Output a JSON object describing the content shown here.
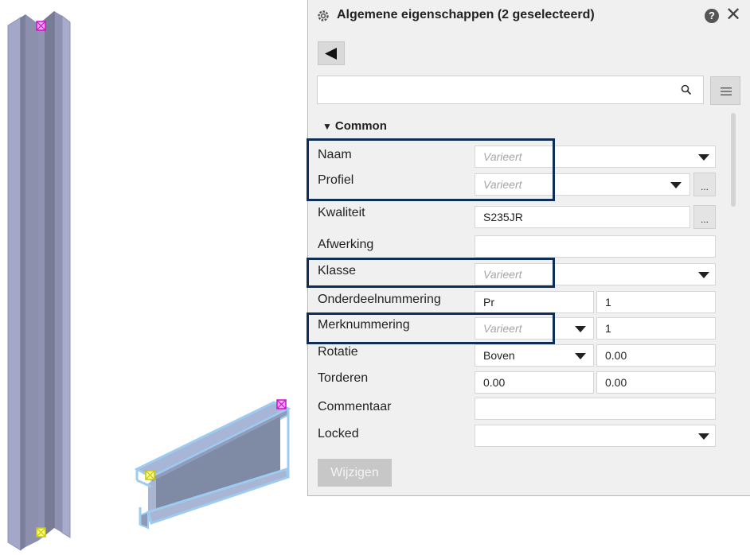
{
  "panel": {
    "title": "Algemene eigenschappen (2 geselecteerd)",
    "help_icon": "?",
    "close_icon": "✕",
    "search": {
      "value": "",
      "placeholder": ""
    },
    "section": "Common",
    "submit_label": "Wijzigen"
  },
  "properties": {
    "naam": {
      "label": "Naam",
      "value": "Varieert"
    },
    "profiel": {
      "label": "Profiel",
      "value": "Varieert",
      "extra": "..."
    },
    "kwaliteit": {
      "label": "Kwaliteit",
      "value": "S235JR",
      "extra": "..."
    },
    "afwerking": {
      "label": "Afwerking",
      "value": ""
    },
    "klasse": {
      "label": "Klasse",
      "value": "Varieert"
    },
    "onderdeelnummering": {
      "label": "Onderdeelnummering",
      "prefix": "Pr",
      "start": "1"
    },
    "merknummering": {
      "label": "Merknummering",
      "prefix": "Varieert",
      "start": "1"
    },
    "rotatie": {
      "label": "Rotatie",
      "value": "Boven",
      "offset": "0.00"
    },
    "tordeeren": {
      "label": "Torderen",
      "value1": "0.00",
      "value2": "0.00"
    },
    "commentaar": {
      "label": "Commentaar",
      "value": ""
    },
    "locked": {
      "label": "Locked",
      "value": ""
    }
  },
  "colors": {
    "highlight": "#0d2e57",
    "handle_magenta": "#e020e0",
    "handle_yellow": "#f0f020",
    "beam_outline": "#9ecbf0"
  }
}
